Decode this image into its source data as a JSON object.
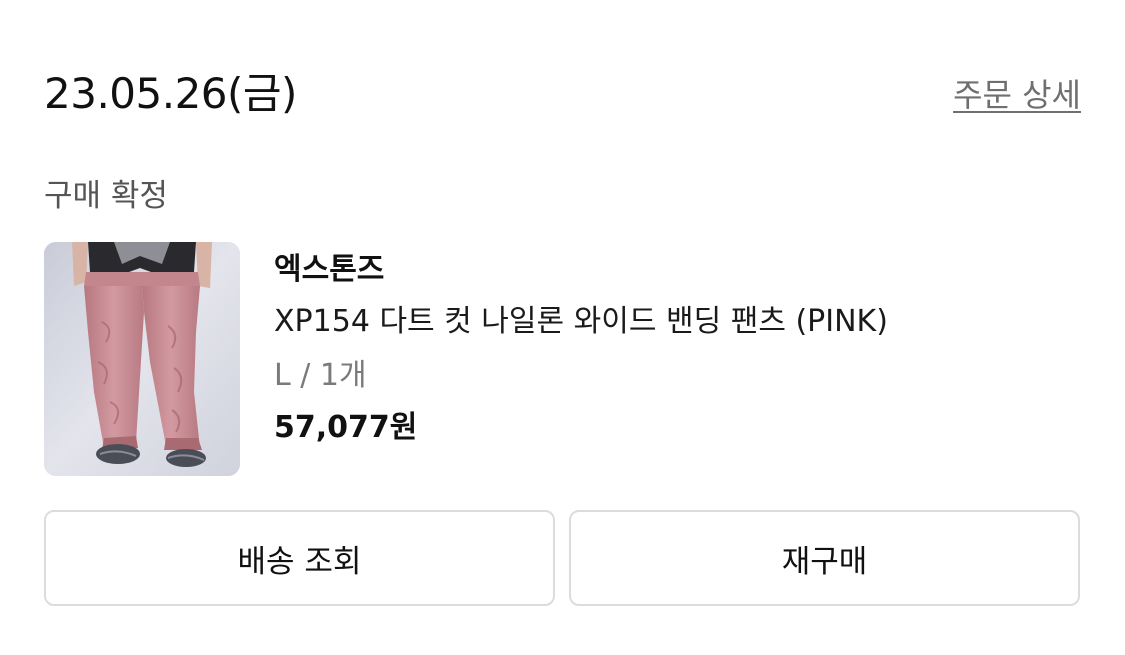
{
  "order": {
    "date": "23.05.26(금)",
    "detail_link_label": "주문 상세",
    "status": "구매 확정"
  },
  "product": {
    "image_icon": "product-photo",
    "brand": "엑스톤즈",
    "name": "XP154 다트 컷 나일론 와이드 밴딩 팬츠 (PINK)",
    "option": "L / 1개",
    "price": "57,077원"
  },
  "actions": {
    "track_label": "배송 조회",
    "rebuy_label": "재구매"
  },
  "colors": {
    "text_primary": "#111111",
    "text_secondary": "#6f6f6f",
    "border": "#dcdcdc",
    "background": "#ffffff",
    "product_color": "#c98f96"
  }
}
